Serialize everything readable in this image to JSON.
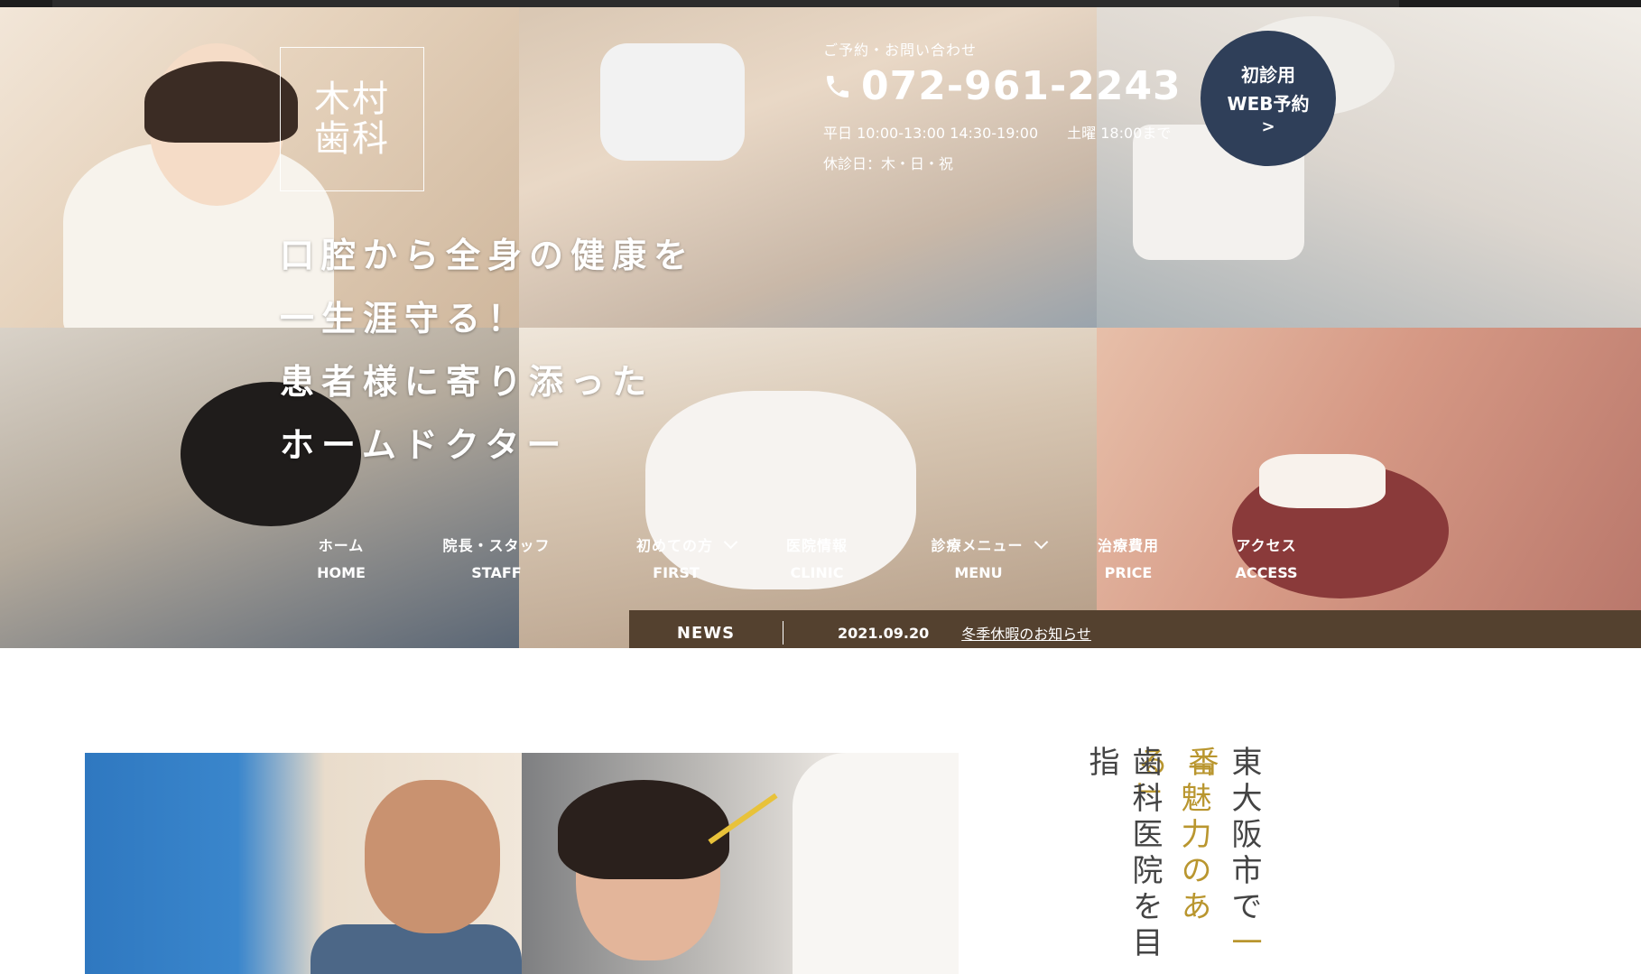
{
  "logo": {
    "line1": "木村",
    "line2": "歯科"
  },
  "tagline": [
    "口腔から全身の健康を",
    "一生涯守る！",
    "患者様に寄り添った",
    "ホームドクター"
  ],
  "contact": {
    "label": "ご予約・お問い合わせ",
    "phone": "072-961-2243",
    "hours": "平日 10:00-13:00 14:30-19:00　　土曜 18:00まで",
    "holiday": "休診日：木・日・祝"
  },
  "web_reservation": {
    "line1": "初診用",
    "line2": "WEB予約",
    "arrow": ">"
  },
  "nav": [
    {
      "jp": "ホーム",
      "en": "HOME",
      "dropdown": false
    },
    {
      "jp": "院長・スタッフ",
      "en": "STAFF",
      "dropdown": false
    },
    {
      "jp": "初めての方",
      "en": "FIRST",
      "dropdown": true
    },
    {
      "jp": "医院情報",
      "en": "CLINIC",
      "dropdown": false
    },
    {
      "jp": "診療メニュー",
      "en": "MENU",
      "dropdown": true
    },
    {
      "jp": "治療費用",
      "en": "PRICE",
      "dropdown": false
    },
    {
      "jp": "アクセス",
      "en": "ACCESS",
      "dropdown": false
    }
  ],
  "news": {
    "label": "NEWS",
    "date": "2021.09.20",
    "title": "冬季休暇のお知らせ"
  },
  "intro": {
    "col1_a": "東大阪市で",
    "col1_b": "一番",
    "col2": "「魅力のある」",
    "col3": "歯科医院を目指"
  },
  "colors": {
    "navy": "#2f3f59",
    "news_bar": "#54412f",
    "gold": "#b9962f"
  }
}
